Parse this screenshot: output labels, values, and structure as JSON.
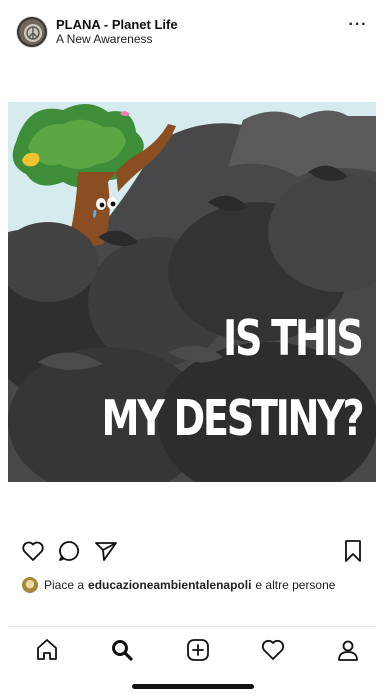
{
  "post": {
    "account_name": "PLANA - Planet Life",
    "account_subtitle": "A New Awareness",
    "image_text_line1": "IS THIS",
    "image_text_line2": "MY DESTINY?",
    "likes": {
      "prefix": "Piace a",
      "user": "educazioneambientalenapoli",
      "suffix": "e altre persone"
    }
  },
  "icons": {
    "more": "more-dots-icon",
    "like": "heart-icon",
    "comment": "comment-icon",
    "share": "paper-plane-icon",
    "save": "bookmark-icon",
    "home": "home-icon",
    "search": "search-icon",
    "new_post": "plus-square-icon",
    "activity": "heart-icon",
    "profile": "profile-icon"
  },
  "colors": {
    "background": "#ffffff",
    "text": "#111111",
    "image_bg": "#3b3b3e"
  }
}
